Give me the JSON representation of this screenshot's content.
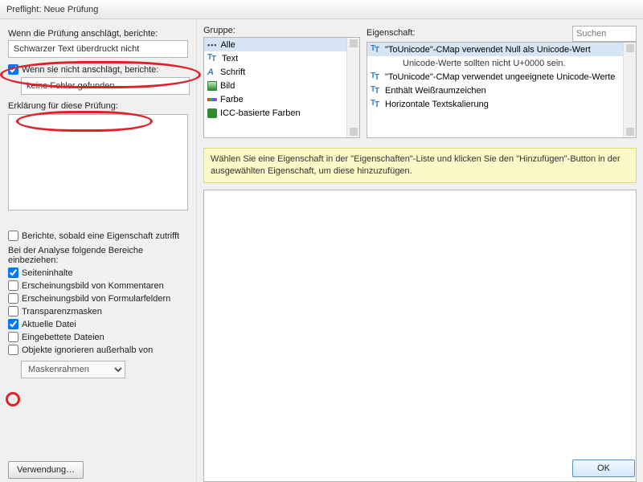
{
  "window": {
    "title": "Preflight: Neue Prüfung"
  },
  "left": {
    "label_hit": "Wenn die Prüfung anschlägt, berichte:",
    "input_hit": "Schwarzer Text überdruckt nicht",
    "chk_nothit_label": "Wenn sie nicht anschlägt, berichte:",
    "input_nothit": "keine Fehler gefunden",
    "label_explain": "Erklärung für diese Prüfung:",
    "chk_report_any": "Berichte, sobald eine Eigenschaft zutrifft",
    "label_analyze": "Bei der Analyse folgende Bereiche einbeziehen:",
    "chk_pagecontent": "Seiteninhalte",
    "chk_comments": "Erscheinungsbild von Kommentaren",
    "chk_formfields": "Erscheinungsbild von Formularfeldern",
    "chk_transparency": "Transparenzmasken",
    "chk_currentfile": "Aktuelle Datei",
    "chk_embedded": "Eingebettete Dateien",
    "chk_ignore": "Objekte ignorieren außerhalb von",
    "select_mask": "Maskenrahmen",
    "btn_usage": "Verwendung…"
  },
  "group": {
    "label": "Gruppe:",
    "items": [
      "Alle",
      "Text",
      "Schrift",
      "Bild",
      "Farbe",
      "ICC-basierte Farben"
    ]
  },
  "property": {
    "label": "Eigenschaft:",
    "search_placeholder": "Suchen",
    "items": [
      "\"ToUnicode\"-CMap verwendet Null als Unicode-Wert",
      "Unicode-Werte sollten nicht U+0000 sein.",
      "\"ToUnicode\"-CMap verwendet ungeeignete Unicode-Werte",
      "Enthält Weißraumzeichen",
      "Horizontale Textskalierung"
    ]
  },
  "hint": "Wählen Sie eine Eigenschaft in der \"Eigenschaften\"-Liste und klicken Sie den \"Hinzufügen\"-Button in der ausgewählten Eigenschaft, um diese hinzuzufügen.",
  "footer": {
    "ok": "OK"
  }
}
